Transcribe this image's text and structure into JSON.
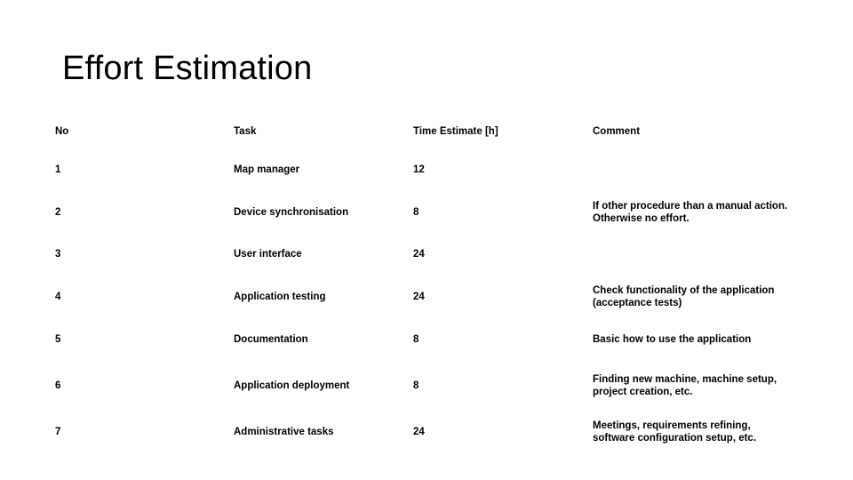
{
  "slide": {
    "title": "Effort Estimation",
    "background_color": "#ffffff",
    "text_color": "#000000"
  },
  "table": {
    "headers": {
      "no": "No",
      "task": "Task",
      "time_estimate": "Time Estimate [h]",
      "comment": "Comment"
    },
    "rows": [
      {
        "no": "1",
        "task": "Map manager",
        "time_estimate": "12",
        "comment": ""
      },
      {
        "no": "2",
        "task": "Device synchronisation",
        "time_estimate": "8",
        "comment": "If other procedure than a manual action. Otherwise no effort."
      },
      {
        "no": "3",
        "task": "User interface",
        "time_estimate": "24",
        "comment": ""
      },
      {
        "no": "4",
        "task": "Application testing",
        "time_estimate": "24",
        "comment": "Check functionality of the application (acceptance tests)"
      },
      {
        "no": "5",
        "task": "Documentation",
        "time_estimate": "8",
        "comment": "Basic how to use the application"
      },
      {
        "no": "6",
        "task": "Application deployment",
        "time_estimate": "8",
        "comment": "Finding new machine, machine setup, project creation, etc."
      },
      {
        "no": "7",
        "task": "Administrative tasks",
        "time_estimate": "24",
        "comment": "Meetings, requirements refining, software configuration setup, etc."
      }
    ]
  }
}
